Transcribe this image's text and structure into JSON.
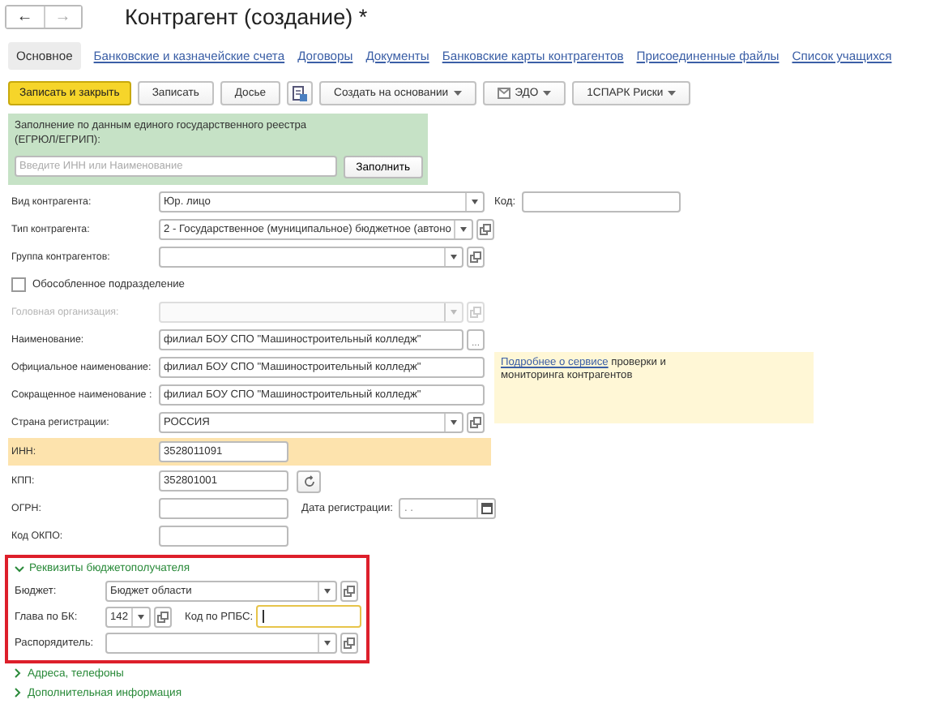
{
  "window": {
    "title": "Контрагент (создание) *"
  },
  "nav": [
    {
      "glyph": "←",
      "disabled": false
    },
    {
      "glyph": "→",
      "disabled": true
    }
  ],
  "tabs": [
    {
      "label": "Основное",
      "selected": true
    },
    {
      "label": "Банковские и казначейские счета",
      "selected": false
    },
    {
      "label": "Договоры",
      "selected": false
    },
    {
      "label": "Документы",
      "selected": false
    },
    {
      "label": "Банковские карты контрагентов",
      "selected": false
    },
    {
      "label": "Присоединенные файлы",
      "selected": false
    },
    {
      "label": "Список учащихся",
      "selected": false
    }
  ],
  "toolbar": [
    {
      "kind": "primary",
      "label": "Записать и закрыть"
    },
    {
      "kind": "plain",
      "label": "Записать"
    },
    {
      "kind": "plain",
      "label": "Досье"
    },
    {
      "kind": "icon"
    },
    {
      "kind": "menu",
      "label": "Создать на основании"
    },
    {
      "kind": "menu_icon",
      "label": "ЭДО"
    },
    {
      "kind": "menu",
      "label": "1СПАРК Риски"
    }
  ],
  "egrul": {
    "caption": "Заполнение по данным единого государственного реестра (ЕГРЮЛ/ЕГРИП):",
    "placeholder": "Введите ИНН или Наименование",
    "button": "Заполнить"
  },
  "code_field": {
    "label": "Код:"
  },
  "fields": [
    {
      "label": "Вид контрагента:",
      "kind": "select",
      "value": "Юр. лицо",
      "open_button": false,
      "disabled": false,
      "highlighted": false
    },
    {
      "label": "Тип контрагента:",
      "kind": "select",
      "value": "2 - Государственное (муниципальное) бюджетное (автоно",
      "open_button": true,
      "disabled": false,
      "highlighted": false
    },
    {
      "label": "Группа контрагентов:",
      "kind": "select",
      "open_button": true,
      "disabled": false,
      "highlighted": false
    },
    {
      "label": "Обособленное подразделение",
      "kind": "checkbox",
      "checked": false,
      "disabled": false,
      "highlighted": false
    },
    {
      "label": "Головная организация:",
      "kind": "select",
      "open_button": true,
      "disabled": true,
      "highlighted": false
    },
    {
      "label": "Наименование:",
      "kind": "input",
      "value": "филиал БОУ СПО \"Машиностроительный колледж\"",
      "button_text": "...",
      "disabled": false,
      "highlighted": false
    },
    {
      "label": "Официальное наименование:",
      "kind": "input",
      "value": "филиал БОУ СПО \"Машиностроительный колледж\"",
      "disabled": false,
      "highlighted": false
    },
    {
      "label": "Сокращенное наименование :",
      "kind": "input",
      "value": "филиал БОУ СПО \"Машиностроительный колледж\"",
      "disabled": false,
      "highlighted": false
    },
    {
      "label": "Страна регистрации:",
      "kind": "select",
      "value": "РОССИЯ",
      "open_button": true,
      "disabled": false,
      "highlighted": false
    },
    {
      "label": "ИНН:",
      "kind": "short",
      "value": "3528011091",
      "disabled": false,
      "highlighted": true
    },
    {
      "label": "КПП:",
      "kind": "short",
      "value": "352801001",
      "refresh_button": true,
      "disabled": false,
      "highlighted": false
    },
    {
      "label": "ОГРН:",
      "kind": "short",
      "disabled": false,
      "highlighted": false,
      "extra": {
        "label": "Дата регистрации:",
        "placeholder": ". ."
      }
    },
    {
      "label": "Код ОКПО:",
      "kind": "short",
      "disabled": false,
      "highlighted": false
    }
  ],
  "service_note": {
    "link": "Подробнее о сервисе",
    "text": "проверки и мониторинга контрагентов"
  },
  "budget": {
    "title": "Реквизиты бюджетополучателя",
    "expanded": true,
    "fields": [
      {
        "label": "Бюджет:",
        "kind": "select",
        "value": "Бюджет области"
      },
      {
        "label": "Глава по БК:",
        "kind": "select_short",
        "value": "142",
        "extra": {
          "label": "Код по РПБС:",
          "focused": true
        }
      },
      {
        "label": "Распорядитель:",
        "kind": "select"
      }
    ]
  },
  "sections": [
    {
      "title": "Адреса, телефоны",
      "expanded": false
    },
    {
      "title": "Дополнительная информация",
      "expanded": false
    }
  ]
}
